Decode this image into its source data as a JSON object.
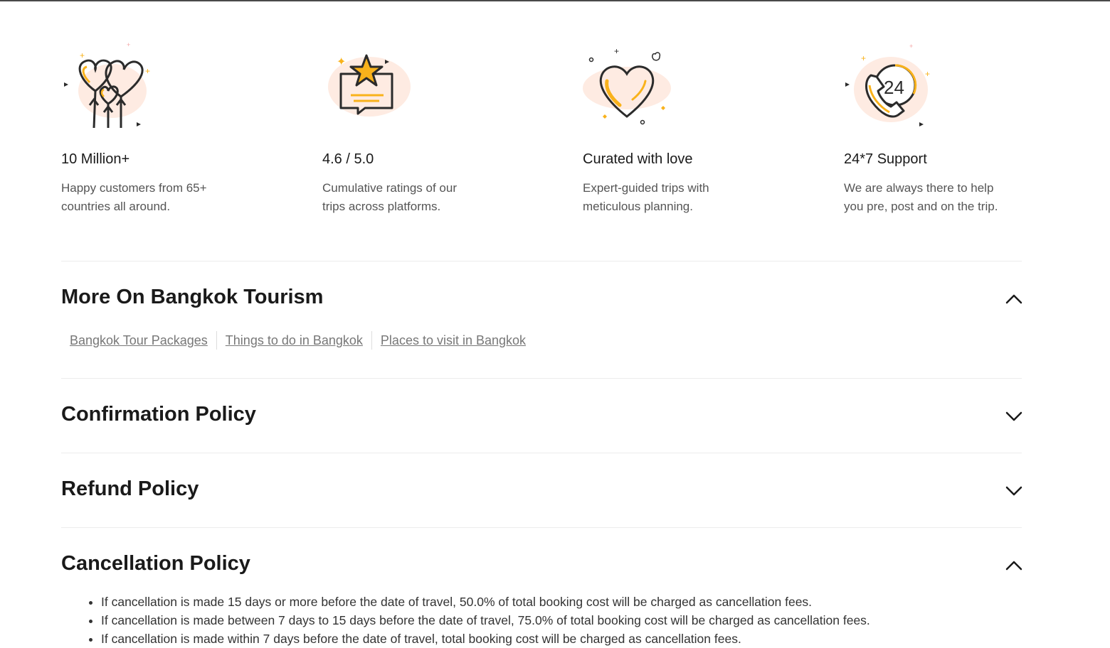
{
  "features": [
    {
      "icon": "heart-balloons-icon",
      "title": "10 Million+",
      "desc_line1": "Happy customers from 65+",
      "desc_line2": "countries all around."
    },
    {
      "icon": "star-rating-icon",
      "title": "4.6 / 5.0",
      "desc_line1": "Cumulative ratings of our",
      "desc_line2": "trips across platforms."
    },
    {
      "icon": "heart-icon",
      "title": "Curated with love",
      "desc_line1": "Expert-guided trips with",
      "desc_line2": "meticulous planning."
    },
    {
      "icon": "phone-24-icon",
      "title": "24*7 Support",
      "desc_line1": "We are always there to help",
      "desc_line2": "you pre, post and on the trip."
    }
  ],
  "sections": {
    "more_on": {
      "title": "More On Bangkok Tourism",
      "expanded": true
    },
    "confirmation": {
      "title": "Confirmation Policy",
      "expanded": false
    },
    "refund": {
      "title": "Refund Policy",
      "expanded": false
    },
    "cancellation": {
      "title": "Cancellation Policy",
      "expanded": true
    }
  },
  "links": [
    "Bangkok Tour Packages",
    "Things to do in Bangkok",
    "Places to visit in Bangkok"
  ],
  "cancellation_items": [
    "If cancellation is made 15 days or more before the date of travel, 50.0% of total booking cost will be charged as cancellation fees.",
    "If cancellation is made between 7 days to 15 days before the date of travel, 75.0% of total booking cost will be charged as cancellation fees.",
    "If cancellation is made within 7 days before the date of travel, total booking cost will be charged as cancellation fees."
  ],
  "colors": {
    "accent": "#F9B21B",
    "blush": "#FDE3D6",
    "ink": "#2B2B2B"
  }
}
